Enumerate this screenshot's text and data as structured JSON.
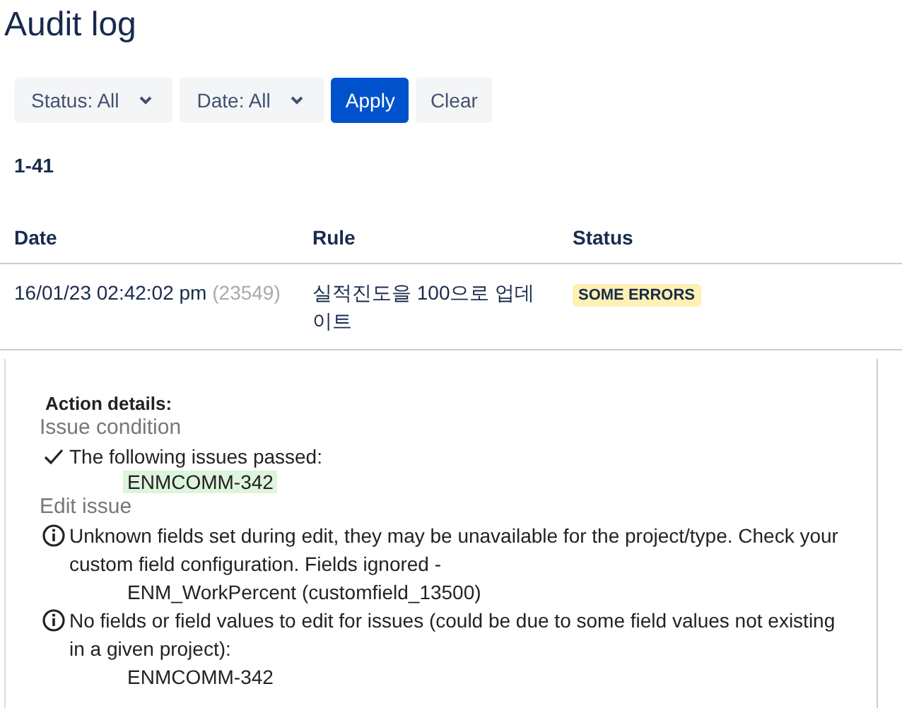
{
  "title": "Audit log",
  "filters": [
    {
      "kind": "dropdown",
      "label": "Status: All"
    },
    {
      "kind": "dropdown",
      "label": "Date: All"
    },
    {
      "kind": "primary",
      "label": "Apply"
    },
    {
      "kind": "plain",
      "label": "Clear"
    }
  ],
  "range": "1-41",
  "table": {
    "columns": [
      "Date",
      "Rule",
      "Status"
    ],
    "rows": [
      {
        "date": "16/01/23 02:42:02 pm",
        "id": "(23549)",
        "rule": "실적진도을 100으로 업데이트",
        "status": "SOME ERRORS",
        "color": "#fff0b3"
      }
    ]
  },
  "details": {
    "heading": "Action details:",
    "sections": [
      {
        "title": "Issue condition",
        "entries": [
          {
            "kind": "check",
            "text": "The following issues passed:",
            "items": [
              {
                "text": "ENMCOMM-342",
                "highlighted": true
              }
            ]
          }
        ]
      },
      {
        "title": "Edit issue",
        "entries": [
          {
            "kind": "info",
            "text": "Unknown fields set during edit, they may be unavailable for the project/type. Check your custom field configuration. Fields ignored -",
            "items": [
              {
                "text": "ENM_WorkPercent (customfield_13500)",
                "highlighted": false
              }
            ]
          },
          {
            "kind": "info",
            "text": "No fields or field values to edit for issues (could be due to some field values not existing in a given project):",
            "items": [
              {
                "text": "ENMCOMM-342",
                "highlighted": false
              }
            ]
          }
        ]
      }
    ]
  }
}
